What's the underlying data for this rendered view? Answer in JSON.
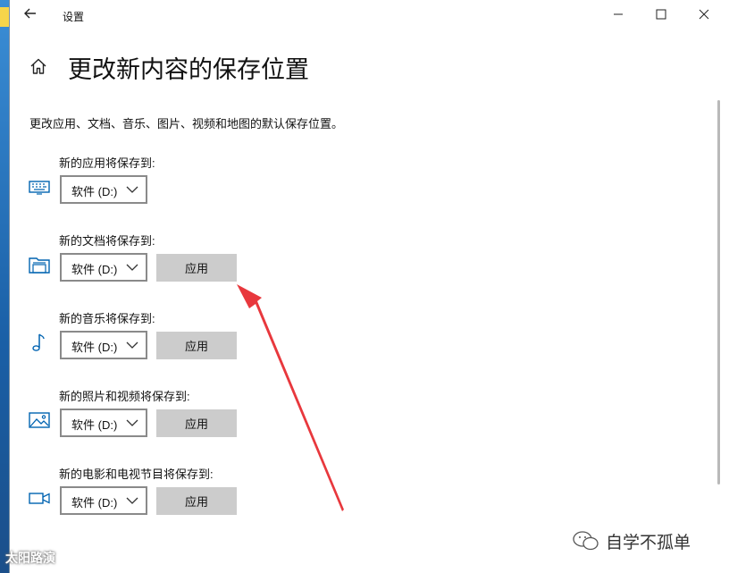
{
  "window": {
    "title": "设置",
    "back_icon": "arrow-left-icon",
    "minimize_icon": "minimize-icon",
    "maximize_icon": "maximize-icon",
    "close_icon": "close-icon"
  },
  "page": {
    "home_icon": "home-icon",
    "title": "更改新内容的保存位置",
    "description": "更改应用、文档、音乐、图片、视频和地图的默认保存位置。"
  },
  "groups": [
    {
      "label": "新的应用将保存到:",
      "icon": "keyboard-icon",
      "drive": "软件 (D:)",
      "apply": ""
    },
    {
      "label": "新的文档将保存到:",
      "icon": "folder-icon",
      "drive": "软件 (D:)",
      "apply": "应用"
    },
    {
      "label": "新的音乐将保存到:",
      "icon": "music-note-icon",
      "drive": "软件 (D:)",
      "apply": "应用"
    },
    {
      "label": "新的照片和视频将保存到:",
      "icon": "picture-icon",
      "drive": "软件 (D:)",
      "apply": "应用"
    },
    {
      "label": "新的电影和电视节目将保存到:",
      "icon": "video-camera-icon",
      "drive": "软件 (D:)",
      "apply": "应用"
    }
  ],
  "watermarks": {
    "left": "太阳路演",
    "right": "自学不孤单"
  },
  "colors": {
    "accent_icon": "#0063b1",
    "annotation_arrow": "#e8383d",
    "apply_button_bg": "#cccccc"
  }
}
